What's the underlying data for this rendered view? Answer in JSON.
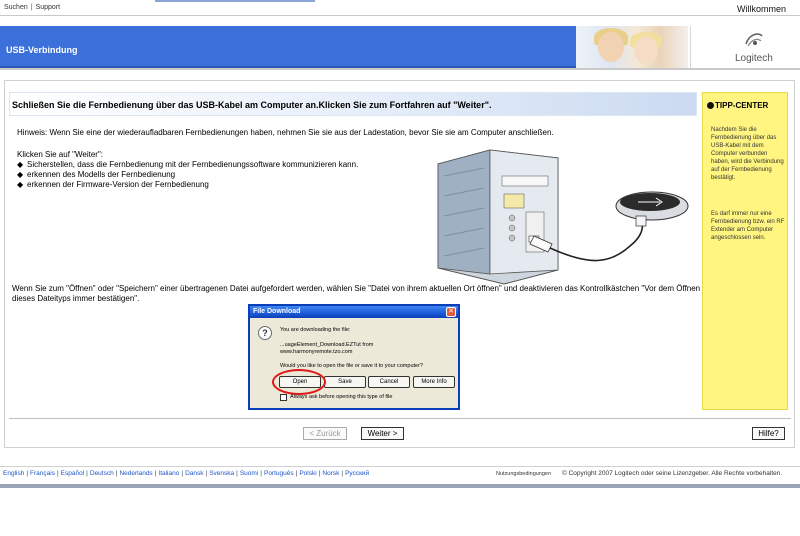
{
  "topbar": {
    "links": [
      "Suchen",
      "Support"
    ],
    "welcome": "Willkommen"
  },
  "header": {
    "title": "USB-Verbindung",
    "logo_text": "Logitech"
  },
  "instruction": "Schließen Sie die Fernbedienung über das USB-Kabel am Computer an.Klicken Sie zum Fortfahren auf \"Weiter\".",
  "content": {
    "hint": "Hinweis: Wenn Sie eine der wiederaufladbaren Fernbedienungen haben, nehmen Sie sie aus der Ladestation, bevor Sie sie am Computer anschließen.",
    "click_intro": "Klicken Sie auf \"Weiter\":",
    "bullets": [
      "Sicherstellen, dass die Fernbedienung mit der Fernbedienungssoftware kommunizieren kann.",
      "erkennen des Modells der Fernbedienung",
      "erkennen der Firmware-Version der Fernbedienung"
    ],
    "open_note": "Wenn Sie zum \"Öffnen\" oder \"Speichern\" einer übertragenen Datei aufgefordert werden, wählen Sie \"Datei von ihrem aktuellen Ort öffnen\" und deaktivieren das Kontrollkästchen \"Vor dem Öffnen dieses Dateityps immer bestätigen\"."
  },
  "tip_center": {
    "title": "TIPP-CENTER",
    "text1": "Nachdem Sie die Fernbedienung über das USB-Kabel mit dem Computer verbunden haben, wird die Verbindung auf der Fernbedienung bestätigt.",
    "text2": "Es darf immer nur eine Fernbedienung bzw. ein RF Extender am Computer angeschlossen sein."
  },
  "dialog": {
    "title": "File Download",
    "line1": "You are downloading the file:",
    "file": "...uageElement_Download.EZTut from",
    "host": "www.harmonyremote.tzo.com",
    "question": "Would you like to open the file or save it to your computer?",
    "buttons": [
      "Open",
      "Save",
      "Cancel",
      "More Info"
    ],
    "checkbox_label": "Always ask before opening this type of file",
    "close_glyph": "✕",
    "icon_glyph": "?"
  },
  "nav": {
    "back": "< Zurück",
    "next": "Weiter >",
    "help": "Hilfe?"
  },
  "footer": {
    "languages": [
      "English",
      "Français",
      "Español",
      "Deutsch",
      "Nederlands",
      "Italiano",
      "Dansk",
      "Svenska",
      "Suomi",
      "Português",
      "Polski",
      "Norsk",
      "Русский"
    ],
    "terms": "Nutzungsbedingungen",
    "copyright": "© Copyright 2007 Logitech oder seine Lizenzgeber. Alle Rechte vorbehalten."
  },
  "colors": {
    "header_blue": "#3b6fd9",
    "tip_yellow": "#fff580",
    "link_blue": "#1f56c7",
    "highlight_red": "#e01818"
  }
}
